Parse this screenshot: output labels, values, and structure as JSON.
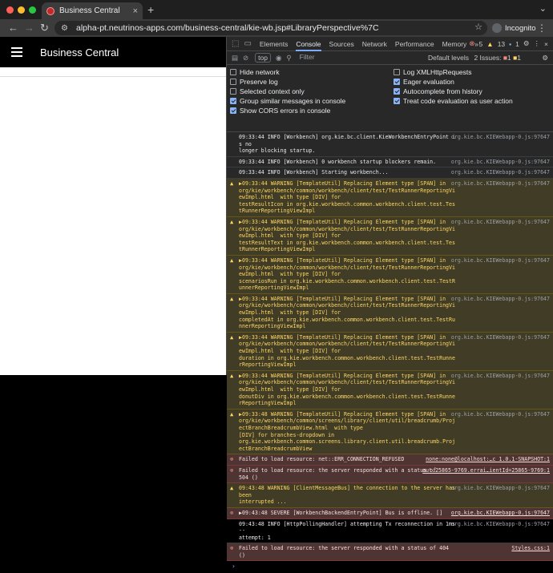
{
  "browser": {
    "tab_title": "Business Central",
    "new_tab": "+",
    "url": "alpha-pt.neutrinos-apps.com/business-central/kie-wb.jsp#LibraryPerspective%7C",
    "incognito_label": "Incognito"
  },
  "app": {
    "title": "Business Central"
  },
  "devtools": {
    "tabs": [
      "Elements",
      "Console",
      "Sources",
      "Network",
      "Performance",
      "Memory",
      "»"
    ],
    "active_tab": "Console",
    "counts": {
      "errors": "5",
      "warnings": "13",
      "info": "1"
    },
    "filter": {
      "context": "top",
      "placeholder": "Filter",
      "levels": "Default levels",
      "issues": "2 Issues:",
      "issues_err": "1",
      "issues_warn": "1"
    },
    "settings": [
      {
        "label": "Hide network",
        "checked": false
      },
      {
        "label": "Log XMLHttpRequests",
        "checked": false
      },
      {
        "label": "Preserve log",
        "checked": false
      },
      {
        "label": "Eager evaluation",
        "checked": true
      },
      {
        "label": "Selected context only",
        "checked": false
      },
      {
        "label": "Autocomplete from history",
        "checked": true
      },
      {
        "label": "Group similar messages in console",
        "checked": true
      },
      {
        "label": "Treat code evaluation as user action",
        "checked": true
      },
      {
        "label": "Show CORS errors in console",
        "checked": true
      }
    ],
    "messages": [
      {
        "level": "info",
        "text": "09:33:44 INFO [Workbench] org.kie.bc.client.KieWorkbenchEntryPoint is no\nlonger blocking startup.",
        "source": "org.kie.bc.KIEWebapp-0.js:97647"
      },
      {
        "level": "info",
        "text": "09:33:44 INFO [Workbench] 0 workbench startup blockers remain.",
        "source": "org.kie.bc.KIEWebapp-0.js:97647"
      },
      {
        "level": "info",
        "text": "09:33:44 INFO [Workbench] Starting workbench...",
        "source": "org.kie.bc.KIEWebapp-0.js:97647"
      },
      {
        "level": "warning",
        "text": "▶09:33:44 WARNING [TemplateUtil] Replacing Element type [SPAN] in\norg/kie/workbench/common/workbench/client/test/TestRunnerReportingViewImpl.html  with type [DIV] for\ntestResultIcon in org.kie.workbench.common.workbench.client.test.TestRunnerReportingViewImpl",
        "source": "org.kie.bc.KIEWebapp-0.js:97647"
      },
      {
        "level": "warning",
        "text": "▶09:33:44 WARNING [TemplateUtil] Replacing Element type [SPAN] in\norg/kie/workbench/common/workbench/client/test/TestRunnerReportingViewImpl.html  with type [DIV] for\ntestResultText in org.kie.workbench.common.workbench.client.test.TestRunnerReportingViewImpl",
        "source": "org.kie.bc.KIEWebapp-0.js:97647"
      },
      {
        "level": "warning",
        "text": "▶09:33:44 WARNING [TemplateUtil] Replacing Element type [SPAN] in\norg/kie/workbench/common/workbench/client/test/TestRunnerReportingViewImpl.html  with type [DIV] for\nscenariosRun in org.kie.workbench.common.workbench.client.test.TestRunnerReportingViewImpl",
        "source": "org.kie.bc.KIEWebapp-0.js:97647"
      },
      {
        "level": "warning",
        "text": "▶09:33:44 WARNING [TemplateUtil] Replacing Element type [SPAN] in\norg/kie/workbench/common/workbench/client/test/TestRunnerReportingViewImpl.html  with type [DIV] for\ncompletedAt in org.kie.workbench.common.workbench.client.test.TestRunnerReportingViewImpl",
        "source": "org.kie.bc.KIEWebapp-0.js:97647"
      },
      {
        "level": "warning",
        "text": "▶09:33:44 WARNING [TemplateUtil] Replacing Element type [SPAN] in\norg/kie/workbench/common/workbench/client/test/TestRunnerReportingViewImpl.html  with type [DIV] for\nduration in org.kie.workbench.common.workbench.client.test.TestRunnerReportingViewImpl",
        "source": "org.kie.bc.KIEWebapp-0.js:97647"
      },
      {
        "level": "warning",
        "text": "▶09:33:44 WARNING [TemplateUtil] Replacing Element type [SPAN] in\norg/kie/workbench/common/workbench/client/test/TestRunnerReportingViewImpl.html  with type [DIV] for\ndonutDiv in org.kie.workbench.common.workbench.client.test.TestRunnerReportingViewImpl",
        "source": "org.kie.bc.KIEWebapp-0.js:97647"
      },
      {
        "level": "warning",
        "text": "▶09:33:48 WARNING [TemplateUtil] Replacing Element type [SPAN] in\norg/kie/workbench/common/screens/library/client/util/breadcrumb/ProjectBranchBreadcrumbView.html  with type\n[DIV] for branches-dropdown in\norg.kie.workbench.common.screens.library.client.util.breadcrumb.ProjectBranchBreadcrumbView",
        "source": "org.kie.bc.KIEWebapp-0.js:97647"
      },
      {
        "level": "error",
        "text": "Failed to load resource: net::ERR_CONNECTION_REFUSED",
        "source": "none:none@localhost:…c_1.0.1-SNAPSHOT:1"
      },
      {
        "level": "error",
        "text": "Failed to load resource: the server responded with a status of\n504 ()",
        "source": "out.25865-9769.errai…ientId=25865-9769:1"
      },
      {
        "level": "warning",
        "text": "09:43:48 WARNING [ClientMessageBus] the connection to the server has been\ninterrupted ...",
        "source": "org.kie.bc.KIEWebapp-0.js:97647"
      },
      {
        "level": "error",
        "text": "▶09:43:48 SEVERE [WorkbenchBackendEntryPoint] Bus is offline. []",
        "source": "org.kie.bc.KIEWebapp-0.js:97647"
      },
      {
        "level": "info",
        "text": "09:43:48 INFO [HttpPollingHandler] attempting Tx reconnection in 1ms --\nattempt: 1",
        "source": "org.kie.bc.KIEWebapp-0.js:97647"
      },
      {
        "level": "error",
        "text": "Failed to load resource: the server responded with a status of 404 ()",
        "source": "Styles.css:1"
      }
    ],
    "prompt": "›"
  }
}
